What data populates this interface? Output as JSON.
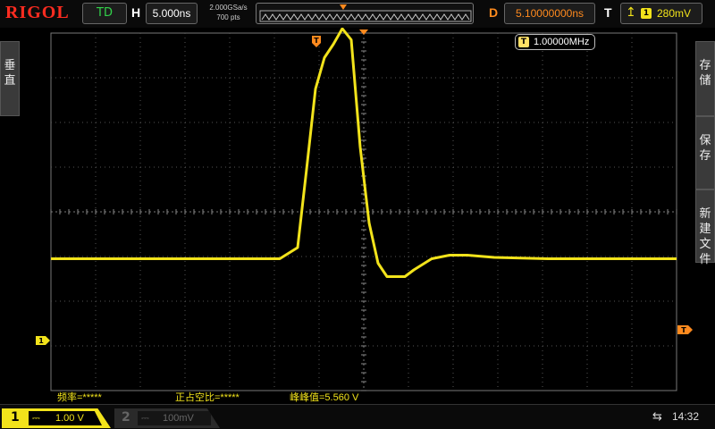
{
  "brand": "RIGOL",
  "top_bar": {
    "trigger_status": "TD",
    "horizontal_label": "H",
    "horizontal_scale": "5.000ns",
    "sample_rate": "2.000GSa/s",
    "memory_depth": "700  pts",
    "delay_label": "D",
    "delay_value": "5.10000000ns",
    "trigger_label": "T",
    "trigger_edge_icon": "rising-edge-icon",
    "trigger_source": "1",
    "trigger_level": "280mV"
  },
  "left_menu_tab": [
    "垂",
    "直"
  ],
  "right_menu_tabs": [
    [
      "存",
      "储"
    ],
    [
      "保",
      "存"
    ],
    [
      "新",
      "建",
      "文",
      "件"
    ]
  ],
  "frequency_counter": {
    "icon_label": "T",
    "value": "1.00000MHz"
  },
  "markers": {
    "trigger_position": "T",
    "trigger_level": "T",
    "ch1_ground": "1"
  },
  "measurements": [
    "频率=*****",
    "正占空比=*****",
    "峰峰值=5.560 V"
  ],
  "bottom_bar": {
    "ch1": {
      "number": "1",
      "coupling_icon": "dc-coupling-icon",
      "coupling_glyph": "⎓",
      "scale": "1.00 V"
    },
    "ch2": {
      "number": "2",
      "coupling_icon": "dc-coupling-icon",
      "coupling_glyph": "⎓",
      "scale": "100mV"
    },
    "usb_icon": "usb-icon",
    "usb_glyph": "⇆",
    "time": "14:32"
  },
  "colors": {
    "ch1": "#f2e31b",
    "trigger_marker": "#ff8a1e",
    "brand": "#ff2c20",
    "td": "#32d24a"
  },
  "chart_data": {
    "type": "line",
    "title": "",
    "xlabel": "",
    "ylabel": "",
    "grid": true,
    "divisions": {
      "x": 14,
      "y": 8
    },
    "xlim": [
      -30.6,
      39.4
    ],
    "ylim": [
      -2.95,
      5.05
    ],
    "x_unit": "ns",
    "y_unit": "V",
    "series": [
      {
        "color": "#f2e31b",
        "x": [
          -30.6,
          -5.0,
          -3.0,
          -2.0,
          -1.0,
          0.0,
          1.0,
          2.0,
          3.0,
          4.0,
          5.0,
          6.0,
          7.0,
          8.0,
          9.0,
          10.0,
          12.0,
          14.0,
          16.0,
          19.0,
          25.0,
          39.4
        ],
        "y": [
          0.0,
          0.0,
          0.25,
          2.0,
          3.8,
          4.5,
          4.8,
          5.15,
          4.9,
          2.5,
          0.8,
          -0.1,
          -0.4,
          -0.4,
          -0.4,
          -0.25,
          0.0,
          0.08,
          0.08,
          0.03,
          0.0,
          0.0
        ]
      }
    ]
  }
}
